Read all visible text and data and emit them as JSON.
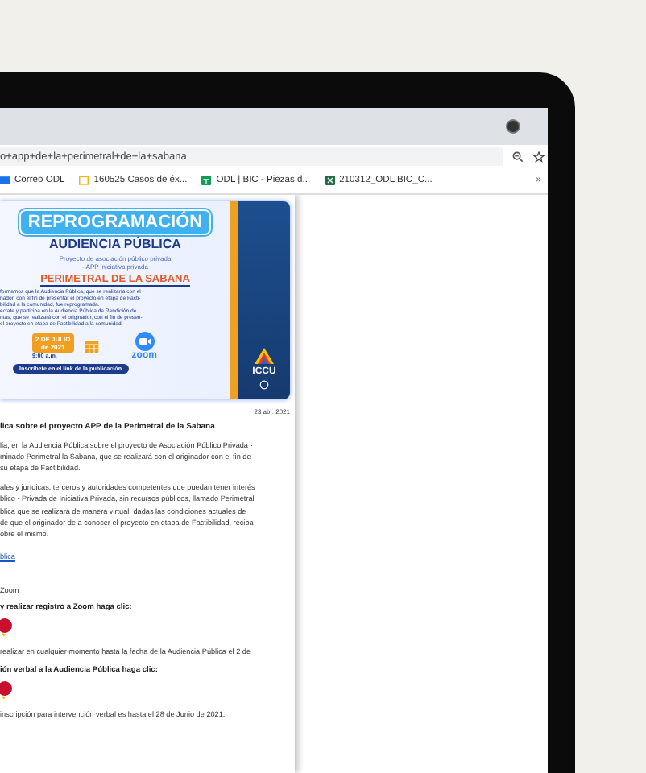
{
  "browser": {
    "address": "o+app+de+la+perimetral+de+la+sabana",
    "bookmarks": [
      {
        "label": "Correo ODL",
        "kind": "mail"
      },
      {
        "label": "160525 Casos de éx...",
        "kind": "slides"
      },
      {
        "label": "ODL | BIC - Piezas d...",
        "kind": "sheets"
      },
      {
        "label": "210312_ODL BIC_C...",
        "kind": "excel"
      }
    ],
    "overflow": "»"
  },
  "banner": {
    "ribbon": "REPROGRAMACIÓN",
    "heading": "AUDIENCIA PÚBLICA",
    "subtitle": "Proyecto de asociación público privada\n- APP iniciativa privada",
    "project": "PERIMETRAL DE LA SABANA",
    "body": "formamos que la Audiencia Pública, que se realizaría con el\nnador, con el fin de presentar el proyecto en etapa de Facti-\nbilidad a la comunidad, fue reprogramada.\nectate y participa en la Audiencia Pública de Rendición de\nntas, que se realizará con el originador, con el fin de presen-\nel proyecto en etapa de Factibilidad a la comunidad.",
    "date": "2 DE JULIO\nde 2021",
    "time": "9:00 a.m.",
    "zoom": "zoom",
    "logo": "ICCU",
    "cta": "Inscríbete en el link de la publicación"
  },
  "post": [
    {
      "kind": "date",
      "text": "23 abr. 2021"
    },
    {
      "kind": "title",
      "text": "lica sobre el proyecto APP de la Perimetral de la Sabana"
    },
    {
      "kind": "para",
      "text": "lia, en la Audiencia Pública sobre el proyecto de Asociación Público Privada -\nminado Perimetral la Sabana, que se realizará con el originador con el fin de\nsu etapa de Factibilidad."
    },
    {
      "kind": "para",
      "text": "ales y jurídicas, terceros y autoridades competentes que puedan tener interés\nblico - Privada de Iniciativa Privada, sin recursos públicos, llamado Perimetral\nblica que se realizará de manera virtual, dadas las condiciones actuales de\nde que el originador de a conocer el proyecto en etapa de Factibilidad, reciba\nobre el mismo."
    },
    {
      "kind": "link",
      "text": "blica"
    },
    {
      "kind": "note",
      "text": "Zoom"
    },
    {
      "kind": "heading",
      "text": "y realizar registro a Zoom haga clic:"
    },
    {
      "kind": "button"
    },
    {
      "kind": "para",
      "text": "realizar en cualquier momento hasta la fecha de la Audiencia Pública el 2 de"
    },
    {
      "kind": "heading",
      "text": "ión verbal a la Audiencia Pública haga clic:"
    },
    {
      "kind": "button"
    },
    {
      "kind": "para",
      "text": "inscripción para intervención verbal es hasta el 28 de Junio de 2021."
    }
  ]
}
